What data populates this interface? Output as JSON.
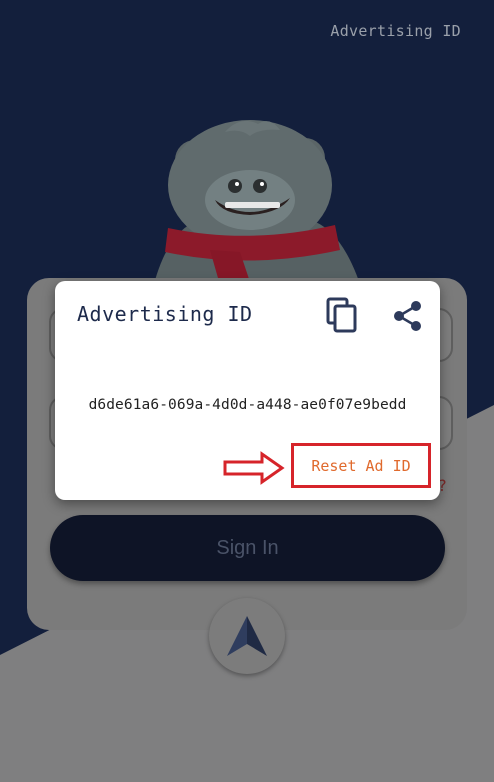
{
  "header": {
    "title": "Advertising ID"
  },
  "login": {
    "sign_in_label": "Sign In",
    "forgot_hint": "?"
  },
  "dialog": {
    "title": "Advertising ID",
    "ad_id": "d6de61a6-069a-4d0d-a448-ae0f07e9bedd",
    "reset_label": "Reset Ad ID",
    "icons": {
      "copy": "copy-icon",
      "share": "share-icon"
    }
  },
  "colors": {
    "navy": "#131f3c",
    "accent_orange": "#e06a2d",
    "highlight_red": "#d6242a"
  }
}
